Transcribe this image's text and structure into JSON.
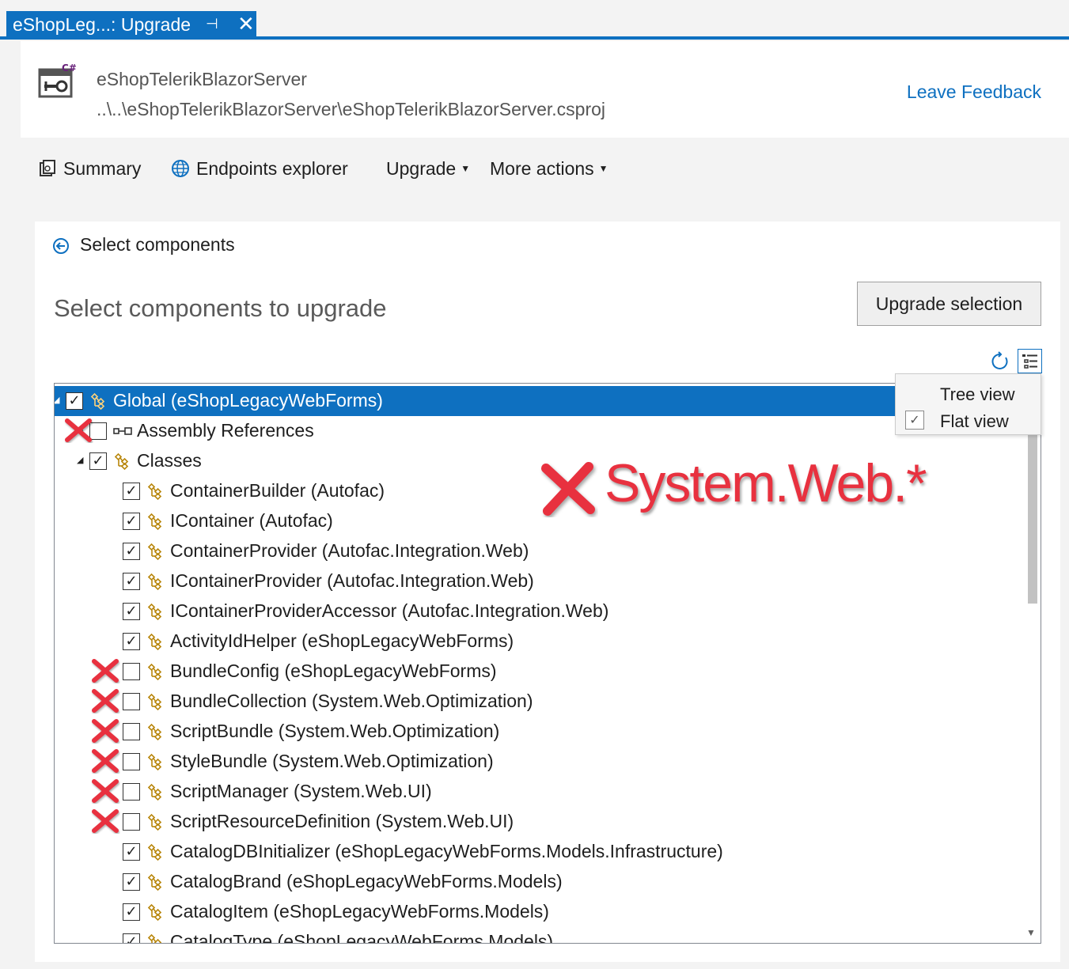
{
  "tab": {
    "title": "eShopLeg...: Upgrade",
    "pin_glyph": "⊣",
    "close_glyph": "✕"
  },
  "header": {
    "project_name": "eShopTelerikBlazorServer",
    "project_path": "..\\..\\eShopTelerikBlazorServer\\eShopTelerikBlazorServer.csproj",
    "feedback_link": "Leave Feedback",
    "icon": "csharp-project-icon"
  },
  "toolbar": {
    "summary": "Summary",
    "endpoints": "Endpoints explorer",
    "upgrade": "Upgrade",
    "more_actions": "More actions"
  },
  "panel": {
    "back_label": "Select components",
    "title": "Select components to upgrade",
    "upgrade_button": "Upgrade selection"
  },
  "view_menu": {
    "tree_view": "Tree view",
    "flat_view": "Flat view",
    "flat_view_checked": true
  },
  "tree": [
    {
      "label": "Global (eShopLegacyWebForms)",
      "checked": true,
      "level": 0,
      "expander": "collapse",
      "icon": "class-icon",
      "selected": true,
      "x_mark": false
    },
    {
      "label": "Assembly References",
      "checked": false,
      "level": 1,
      "expander": "expand",
      "icon": "reference-icon",
      "selected": false,
      "x_mark": true
    },
    {
      "label": "Classes",
      "checked": true,
      "level": 1,
      "expander": "collapse",
      "icon": "class-icon",
      "selected": false,
      "x_mark": false
    },
    {
      "label": "ContainerBuilder (Autofac)",
      "checked": true,
      "level": 2,
      "icon": "class-icon",
      "x_mark": false
    },
    {
      "label": "IContainer (Autofac)",
      "checked": true,
      "level": 2,
      "icon": "class-icon",
      "x_mark": false
    },
    {
      "label": "ContainerProvider (Autofac.Integration.Web)",
      "checked": true,
      "level": 2,
      "icon": "class-icon",
      "x_mark": false
    },
    {
      "label": "IContainerProvider (Autofac.Integration.Web)",
      "checked": true,
      "level": 2,
      "icon": "class-icon",
      "x_mark": false
    },
    {
      "label": "IContainerProviderAccessor (Autofac.Integration.Web)",
      "checked": true,
      "level": 2,
      "icon": "class-icon",
      "x_mark": false
    },
    {
      "label": "ActivityIdHelper (eShopLegacyWebForms)",
      "checked": true,
      "level": 2,
      "icon": "class-icon",
      "x_mark": false
    },
    {
      "label": "BundleConfig (eShopLegacyWebForms)",
      "checked": false,
      "level": 2,
      "icon": "class-icon",
      "x_mark": true
    },
    {
      "label": "BundleCollection (System.Web.Optimization)",
      "checked": false,
      "level": 2,
      "icon": "class-icon",
      "x_mark": true
    },
    {
      "label": "ScriptBundle (System.Web.Optimization)",
      "checked": false,
      "level": 2,
      "icon": "class-icon",
      "x_mark": true
    },
    {
      "label": "StyleBundle (System.Web.Optimization)",
      "checked": false,
      "level": 2,
      "icon": "class-icon",
      "x_mark": true
    },
    {
      "label": "ScriptManager (System.Web.UI)",
      "checked": false,
      "level": 2,
      "icon": "class-icon",
      "x_mark": true
    },
    {
      "label": "ScriptResourceDefinition (System.Web.UI)",
      "checked": false,
      "level": 2,
      "icon": "class-icon",
      "x_mark": true
    },
    {
      "label": "CatalogDBInitializer (eShopLegacyWebForms.Models.Infrastructure)",
      "checked": true,
      "level": 2,
      "icon": "class-icon",
      "x_mark": false
    },
    {
      "label": "CatalogBrand (eShopLegacyWebForms.Models)",
      "checked": true,
      "level": 2,
      "icon": "class-icon",
      "x_mark": false
    },
    {
      "label": "CatalogItem (eShopLegacyWebForms.Models)",
      "checked": true,
      "level": 2,
      "icon": "class-icon",
      "x_mark": false
    },
    {
      "label": "CatalogType (eShopLegacyWebForms.Models)",
      "checked": true,
      "level": 2,
      "icon": "class-icon",
      "x_mark": false
    }
  ],
  "annotation": {
    "text": "System.Web.*",
    "color": "#e8313f"
  },
  "colors": {
    "accent": "#0e70c0",
    "x_mark": "#e8313f",
    "class_icon": "#b8860b"
  }
}
